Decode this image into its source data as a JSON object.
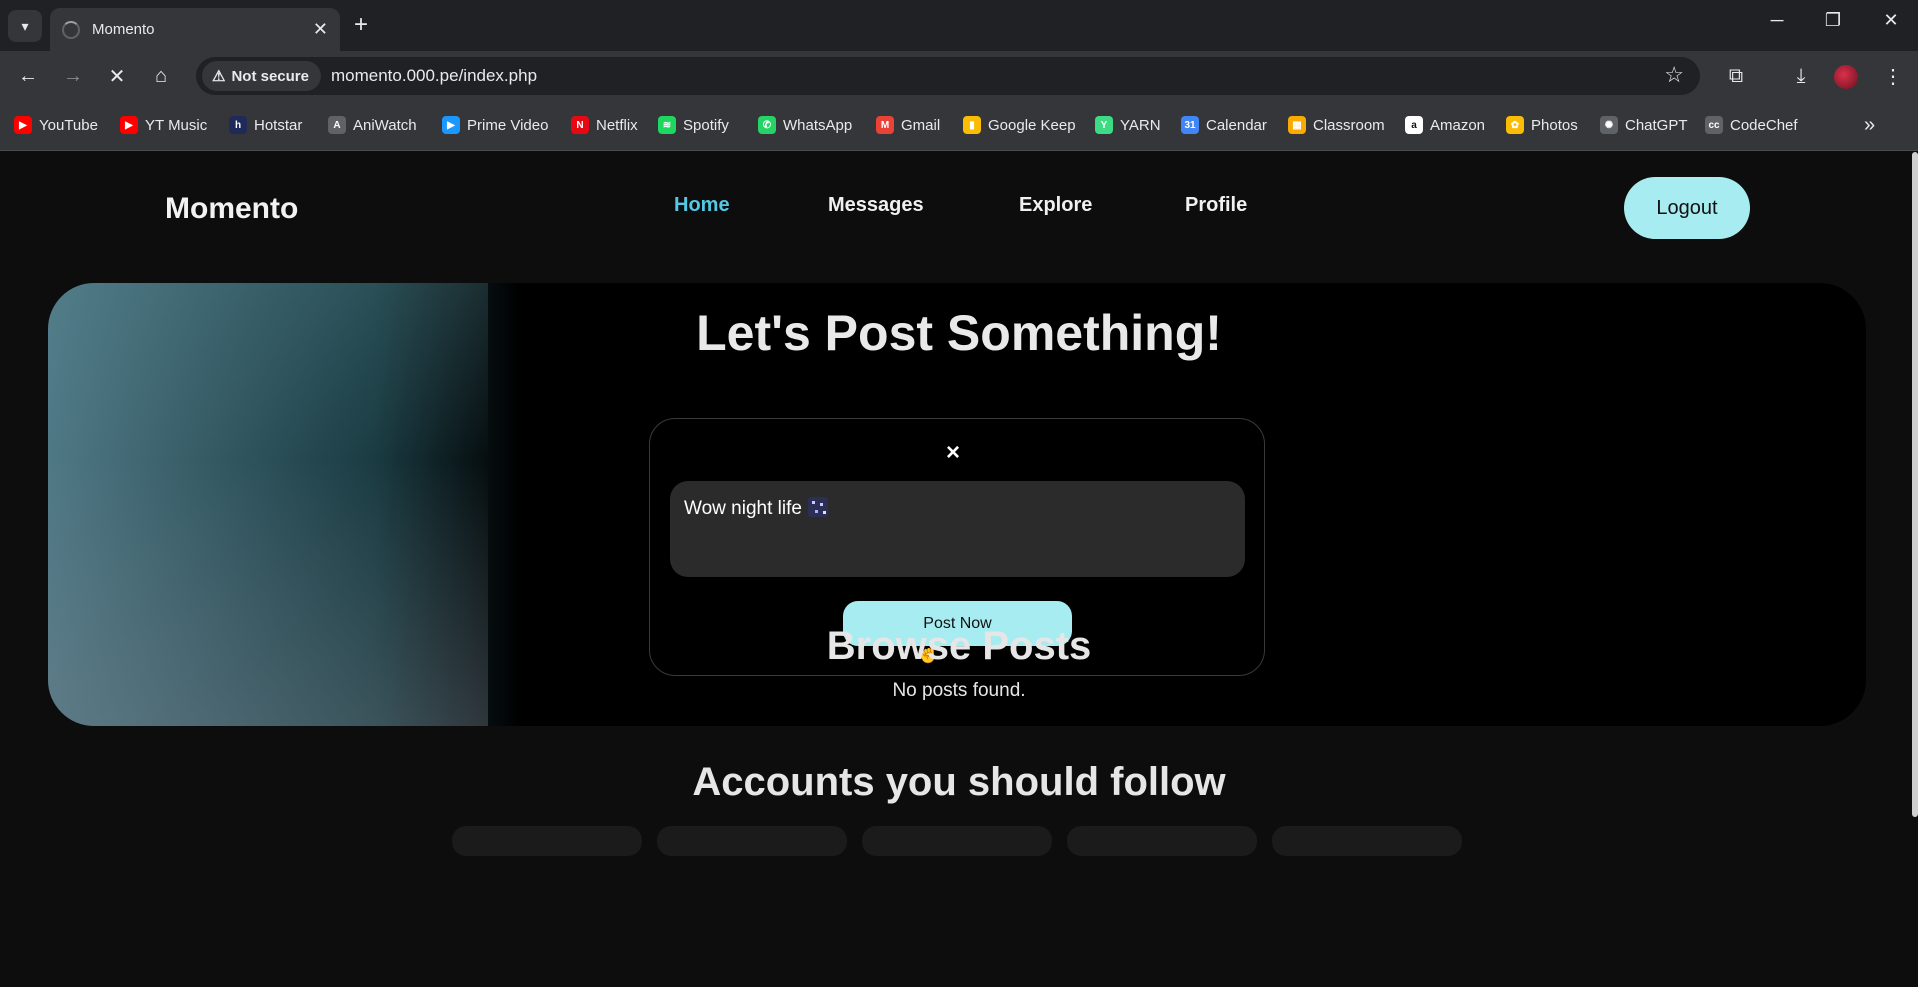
{
  "browser": {
    "tab_title": "Momento",
    "not_secure_label": "Not secure",
    "url": "momento.000.pe/index.php",
    "bookmarks": [
      {
        "label": "YouTube",
        "icon": "youtube-icon",
        "color": "#ff0000"
      },
      {
        "label": "YT Music",
        "icon": "yt-music-icon",
        "color": "#ff0000"
      },
      {
        "label": "Hotstar",
        "icon": "hotstar-icon",
        "color": "#1f2a5a"
      },
      {
        "label": "AniWatch",
        "icon": "aniwatch-icon",
        "color": "#e8eaed"
      },
      {
        "label": "Prime Video",
        "icon": "prime-video-icon",
        "color": "#1a98ff"
      },
      {
        "label": "Netflix",
        "icon": "netflix-icon",
        "color": "#e50914"
      },
      {
        "label": "Spotify",
        "icon": "spotify-icon",
        "color": "#1ed760"
      },
      {
        "label": "WhatsApp",
        "icon": "whatsapp-icon",
        "color": "#25d366"
      },
      {
        "label": "Gmail",
        "icon": "gmail-icon",
        "color": "#ea4335"
      },
      {
        "label": "Google Keep",
        "icon": "google-keep-icon",
        "color": "#fbbc04"
      },
      {
        "label": "YARN",
        "icon": "yarn-icon",
        "color": "#3ddc84"
      },
      {
        "label": "Calendar",
        "icon": "calendar-icon",
        "color": "#4285f4"
      },
      {
        "label": "Classroom",
        "icon": "classroom-icon",
        "color": "#f9ab00"
      },
      {
        "label": "Amazon",
        "icon": "amazon-icon",
        "color": "#ffffff"
      },
      {
        "label": "Photos",
        "icon": "photos-icon",
        "color": "#fbbc04"
      },
      {
        "label": "ChatGPT",
        "icon": "chatgpt-icon",
        "color": "#e8eaed"
      },
      {
        "label": "CodeChef",
        "icon": "codechef-icon",
        "color": "#e8eaed"
      }
    ]
  },
  "site": {
    "brand": "Momento",
    "nav": {
      "home": "Home",
      "messages": "Messages",
      "explore": "Explore",
      "profile": "Profile"
    },
    "logout_label": "Logout",
    "accent_color": "#a7ecf1",
    "active_nav_color": "#54c7e4"
  },
  "composer": {
    "heading": "Let's Post Something!",
    "close_label": "×",
    "post_text": "Wow night life",
    "post_button": "Post Now"
  },
  "browse": {
    "heading": "Browse Posts",
    "empty_text": "No posts found."
  },
  "follow": {
    "heading": "Accounts you should follow"
  }
}
